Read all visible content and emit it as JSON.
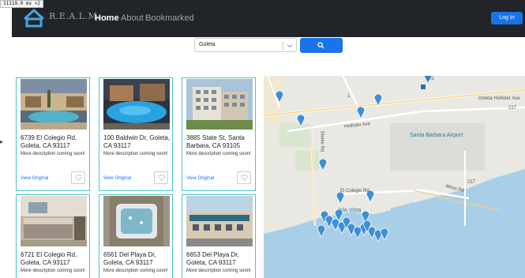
{
  "perf_badge": "11119.0 ms ×2",
  "navbar": {
    "brand": "R.E.A.L.M.",
    "links": [
      {
        "label": "Home",
        "active": true
      },
      {
        "label": "About",
        "active": false
      },
      {
        "label": "Bookmarked",
        "active": false
      }
    ],
    "login_label": "Log In"
  },
  "search": {
    "value": "Goleta"
  },
  "listings": [
    {
      "address": "6739 El Colegio Rd, Goleta, CA 93117",
      "description": "More description coming soon!",
      "link": "View Original"
    },
    {
      "address": "100 Baldwin Dr, Goleta, CA 93117",
      "description": "More description coming soon!",
      "link": "View Original"
    },
    {
      "address": "3885 State St, Santa Barbara, CA 93105",
      "description": "More description coming soon!",
      "link": "View Original"
    },
    {
      "address": "6721 El Colegio Rd, Goleta, CA 93117",
      "description": "More description coming soon!",
      "link": "View Original"
    },
    {
      "address": "6561 Del Playa Dr, Goleta, CA 93117",
      "description": "More description coming soon!",
      "link": "View Original"
    },
    {
      "address": "6653 Del Playa Dr, Goleta, CA 93117",
      "description": "More description coming soon!",
      "link": "View Original"
    }
  ],
  "map": {
    "labels": {
      "goleta": "Goleta",
      "santa_barbara_airport": "Santa Barbara Airport",
      "el_colegio": "El Colegio Rd",
      "isla_vista": "Isla Vista",
      "hollister": "Hollister Ave",
      "storke": "Storke Rd",
      "mesa": "Mesa Rd",
      "hollister_right": "Goleta Hollister Ave",
      "route_217_a": "217",
      "route_217_b": "217",
      "route_101": "101",
      "route_1": "1"
    }
  },
  "colors": {
    "navbar": "#212529",
    "accent": "#1a73e8",
    "card_border": "#49c5cc",
    "water": "#a9cfe8",
    "marker": "#3d8fd8"
  },
  "icons": [
    "realm-logo-icon",
    "search-icon",
    "chevron-down-icon",
    "heart-icon",
    "map-marker-icon"
  ]
}
